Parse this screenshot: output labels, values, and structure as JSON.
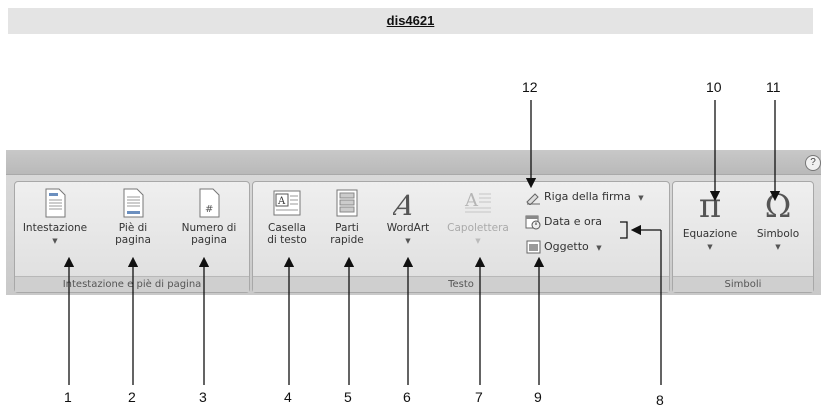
{
  "header": {
    "title": "dis4621"
  },
  "help_icon": "?",
  "groups": {
    "header_footer": {
      "label": "Intestazione e piè di pagina",
      "buttons": [
        {
          "label": "Intestazione",
          "icon": "page-header-icon"
        },
        {
          "label": "Piè di\npagina",
          "icon": "page-footer-icon"
        },
        {
          "label": "Numero di\npagina",
          "icon": "page-number-icon"
        }
      ]
    },
    "text": {
      "label": "Testo",
      "buttons": [
        {
          "label": "Casella\ndi testo",
          "icon": "text-box-icon"
        },
        {
          "label": "Parti\nrapide",
          "icon": "quick-parts-icon"
        },
        {
          "label": "WordArt",
          "icon": "wordart-icon"
        },
        {
          "label": "Capolettera",
          "icon": "drop-cap-icon"
        }
      ],
      "small_buttons": [
        {
          "label": "Riga della firma",
          "icon": "signature-line-icon"
        },
        {
          "label": "Data e ora",
          "icon": "date-time-icon"
        },
        {
          "label": "Oggetto",
          "icon": "object-icon"
        }
      ]
    },
    "symbols": {
      "label": "Simboli",
      "buttons": [
        {
          "label": "Equazione",
          "icon": "pi-icon",
          "glyph": "π"
        },
        {
          "label": "Simbolo",
          "icon": "omega-icon",
          "glyph": "Ω"
        }
      ]
    }
  },
  "callouts": [
    "1",
    "2",
    "3",
    "4",
    "5",
    "6",
    "7",
    "8",
    "9",
    "10",
    "11",
    "12"
  ]
}
